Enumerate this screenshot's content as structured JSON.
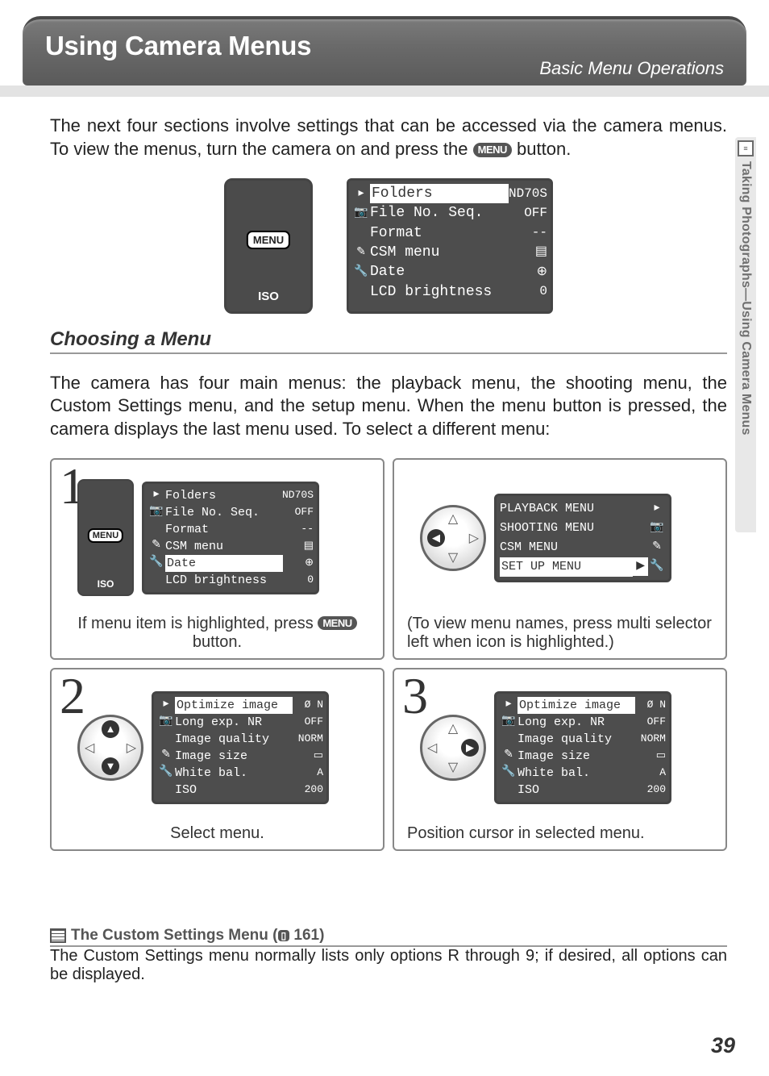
{
  "header": {
    "title": "Using Camera Menus",
    "subtitle": "Basic Menu Operations"
  },
  "sidebar": {
    "text": "Taking Photographs—Using Camera Menus"
  },
  "intro": {
    "text_before_badge": "The next four sections involve settings that can be accessed via the camera menus.  To view the menus, turn the camera on and press the ",
    "badge": "MENU",
    "text_after_badge": " button."
  },
  "camera_btn": {
    "label": "MENU",
    "sublabel": "ISO"
  },
  "setup_menu": {
    "rows": [
      {
        "icon": "▸",
        "label": "Folders",
        "val": "ND70S",
        "highlight": true
      },
      {
        "icon": "📷",
        "label": "File No. Seq.",
        "val": "OFF"
      },
      {
        "icon": "",
        "label": "Format",
        "val": "--"
      },
      {
        "icon": "✎",
        "label": "CSM menu",
        "val": "▤"
      },
      {
        "icon": "🔧",
        "label": "Date",
        "val": "⊕"
      },
      {
        "icon": "",
        "label": "LCD brightness",
        "val": "0"
      }
    ]
  },
  "choosing": {
    "heading": "Choosing a Menu",
    "body": "The camera has four main menus: the playback menu, the shooting menu, the Custom Settings menu, and the setup menu.  When the menu button is pressed, the camera displays the last menu used.  To select a different menu:"
  },
  "step1": {
    "num": "1",
    "menu": {
      "rows": [
        {
          "icon": "▸",
          "label": "Folders",
          "val": "ND70S"
        },
        {
          "icon": "📷",
          "label": "File No. Seq.",
          "val": "OFF"
        },
        {
          "icon": "",
          "label": "Format",
          "val": "--"
        },
        {
          "icon": "✎",
          "label": "CSM menu",
          "val": "▤"
        },
        {
          "icon": "🔧",
          "label": "Date",
          "val": "⊕",
          "selected": true
        },
        {
          "icon": "",
          "label": "LCD brightness",
          "val": "0"
        }
      ]
    },
    "caption_before": "If menu item is highlighted, press ",
    "caption_badge": "MENU",
    "caption_after": " button.",
    "names": {
      "rows": [
        {
          "label": "PLAYBACK MENU",
          "icon": "▸"
        },
        {
          "label": "SHOOTING MENU",
          "icon": "📷"
        },
        {
          "label": "CSM MENU",
          "icon": "✎"
        },
        {
          "label": "SET UP MENU",
          "icon": "🔧",
          "selected": true
        }
      ]
    },
    "names_caption": "(To view menu names, press multi selector left when icon is highlighted.)"
  },
  "shooting_menu": {
    "rows": [
      {
        "icon": "▸",
        "label": "Optimize image",
        "val": "Ø N"
      },
      {
        "icon": "📷",
        "label": "Long exp. NR",
        "val": "OFF"
      },
      {
        "icon": "",
        "label": "Image quality",
        "val": "NORM"
      },
      {
        "icon": "✎",
        "label": "Image size",
        "val": "▭"
      },
      {
        "icon": "🔧",
        "label": "White bal.",
        "val": "A"
      },
      {
        "icon": "",
        "label": "ISO",
        "val": "200"
      }
    ]
  },
  "step2": {
    "num": "2",
    "caption": "Select menu."
  },
  "step3": {
    "num": "3",
    "caption": "Position cursor in selected menu."
  },
  "footnote": {
    "heading_before": "The Custom Settings Menu (",
    "heading_page": " 161)",
    "body": "The Custom Settings menu normally lists only options R through 9; if desired, all options can be displayed."
  },
  "page_number": "39"
}
